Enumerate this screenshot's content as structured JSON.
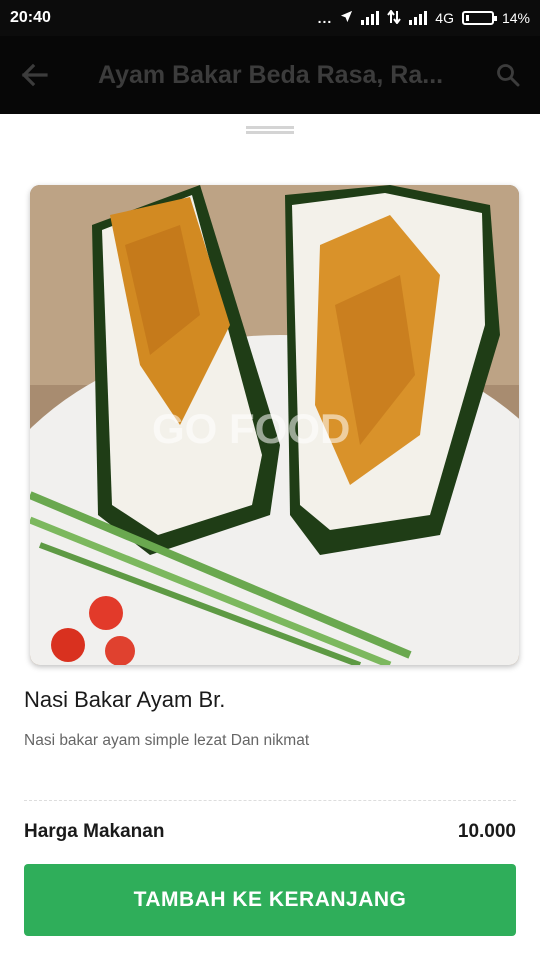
{
  "status_bar": {
    "time": "20:40",
    "dots": "...",
    "network": "4G",
    "battery_percent": "14%",
    "battery_level": 0.14
  },
  "app_bar": {
    "title": "Ayam Bakar Beda Rasa, Ra...",
    "back_icon": "arrow-left-icon",
    "search_icon": "search-icon"
  },
  "item": {
    "photo_watermark": "GO FOOD",
    "name": "Nasi Bakar Ayam Br.",
    "description": "Nasi bakar ayam simple lezat Dan nikmat"
  },
  "price": {
    "label": "Harga Makanan",
    "value": "10.000"
  },
  "cta": {
    "label": "TAMBAH KE KERANJANG"
  },
  "colors": {
    "accent": "#2fae5a",
    "app_bar": "#070707",
    "status_bar": "#0c0c0c"
  }
}
